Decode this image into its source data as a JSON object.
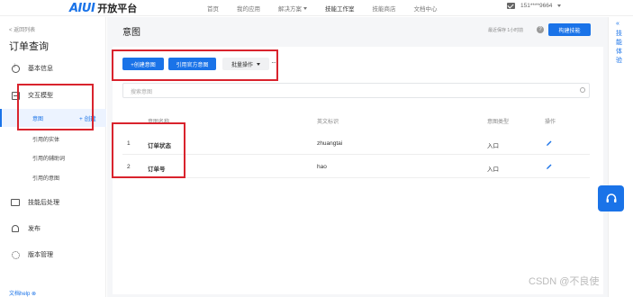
{
  "topbar": {
    "logo_mark": "AIUI",
    "logo_text": "开放平台",
    "nav": [
      {
        "label": "首页",
        "dropdown": false
      },
      {
        "label": "我的应用",
        "dropdown": false
      },
      {
        "label": "解决方案",
        "dropdown": true
      },
      {
        "label": "技能工作室",
        "dropdown": false,
        "active": true
      },
      {
        "label": "技能商店",
        "dropdown": false
      },
      {
        "label": "文档中心",
        "dropdown": false
      }
    ],
    "user_phone": "151****9664",
    "icons": {
      "mail": "mail-icon",
      "user_caret": "chevron-down-icon"
    }
  },
  "sidebar": {
    "back_label": "< 返回列表",
    "title": "订单查询",
    "items": [
      {
        "label": "基本信息",
        "icon": "info-icon"
      },
      {
        "label": "交互模型",
        "icon": "model-icon"
      },
      {
        "label": "技能后处理",
        "icon": "image-icon"
      },
      {
        "label": "发布",
        "icon": "bell-icon"
      },
      {
        "label": "版本管理",
        "icon": "gear-icon"
      }
    ],
    "sub_items": {
      "active": "意图",
      "create": "+ 创建",
      "others": [
        "引用的实体",
        "引用的辅助词",
        "引用的意图"
      ]
    },
    "doc_link": "文档help ⊗"
  },
  "main": {
    "title": "意图",
    "last_save": "最近保存 1小时前",
    "help": "?",
    "build_button": "构建技能",
    "buttons": {
      "create_intent": "+创建意图",
      "reference_official": "引用官方意图",
      "batch": "批量操作",
      "more": "···"
    },
    "search_placeholder": "搜索意图",
    "table": {
      "headers": [
        "意图名称",
        "英文标识",
        "意图类型",
        "操作"
      ],
      "rows": [
        {
          "index": "1",
          "name": "订单状态",
          "english_id": "zhuangtai",
          "type": "入口"
        },
        {
          "index": "2",
          "name": "订单号",
          "english_id": "hao",
          "type": "入口"
        }
      ]
    }
  },
  "rail": {
    "chevron": "«",
    "text": "技能体验"
  },
  "watermark": "CSDN @不良使",
  "colors": {
    "accent": "#1a73e8",
    "highlight": "#d9232d"
  }
}
